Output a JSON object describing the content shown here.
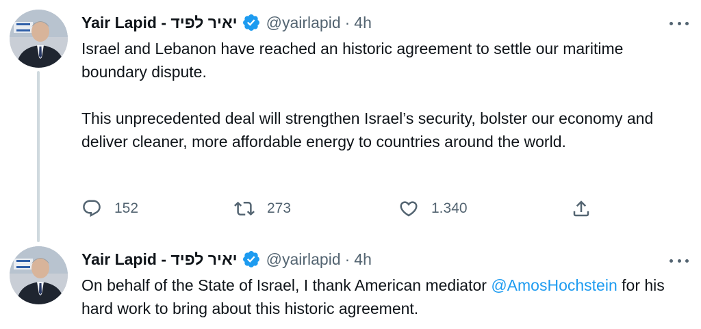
{
  "tweets": [
    {
      "author": {
        "display_name": "Yair Lapid - יאיר לפיד",
        "handle": "@yairlapid",
        "verified": true
      },
      "separator": "·",
      "time": "4h",
      "paragraphs": [
        "Israel and Lebanon have reached an historic agreement to settle our maritime boundary dispute.",
        "This unprecedented deal will strengthen Israel’s security, bolster our economy and deliver cleaner, more affordable energy to countries around the world."
      ],
      "stats": {
        "replies": "152",
        "retweets": "273",
        "likes": "1.340"
      }
    },
    {
      "author": {
        "display_name": "Yair Lapid - יאיר לפיד",
        "handle": "@yairlapid",
        "verified": true
      },
      "separator": "·",
      "time": "4h",
      "text_before": "On behalf of the State of Israel, I thank American mediator ",
      "mention": "@AmosHochstein",
      "text_after": " for his hard work to bring about this historic agreement."
    }
  ],
  "icons": {
    "reply": "reply-icon",
    "retweet": "retweet-icon",
    "like": "heart-icon",
    "share": "share-icon",
    "verified": "verified-badge-icon",
    "more": "more-options-icon"
  },
  "colors": {
    "text": "#0f1419",
    "secondary": "#536471",
    "link": "#1d9bf0",
    "verified": "#1d9bf0",
    "thread_line": "#cfd9de"
  }
}
